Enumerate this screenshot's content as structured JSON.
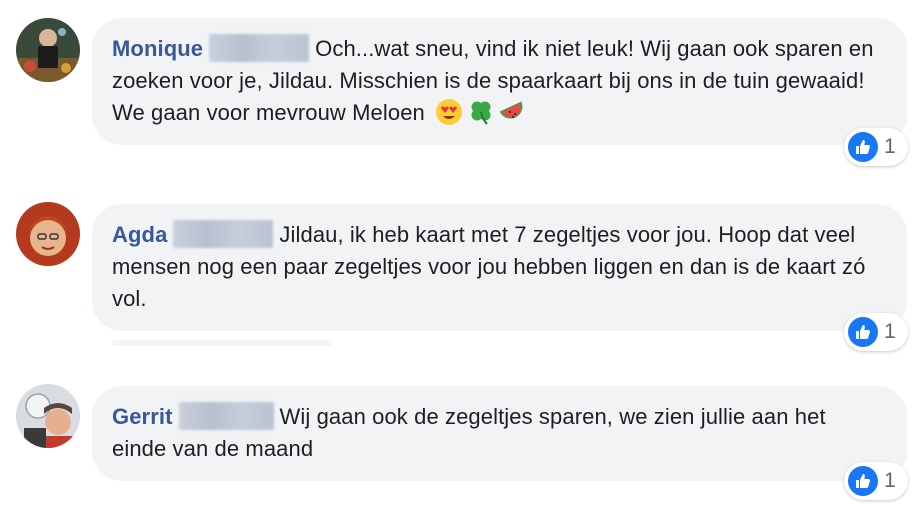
{
  "comments": [
    {
      "author": "Monique",
      "text": "Och...wat sneu, vind ik niet leuk! Wij gaan ook sparen en zoeken voor je, Jildau. Misschien is de spaarkaart bij ons in de tuin gewaaid! We gaan voor mevrouw Meloen",
      "emojis": [
        "heart-eyes-emoji",
        "four-leaf-clover-emoji",
        "watermelon-emoji"
      ],
      "reaction": {
        "icon": "like-icon",
        "count": "1"
      }
    },
    {
      "author": "Agda",
      "text": "Jildau, ik heb kaart met 7 zegeltjes voor jou. Hoop dat veel mensen nog een paar zegeltjes voor jou hebben liggen en dan is de kaart zó vol.",
      "reaction": {
        "icon": "like-icon",
        "count": "1"
      }
    },
    {
      "author": "Gerrit",
      "text": "Wij gaan ook de zegeltjes sparen, we zien jullie aan het einde van de maand",
      "reaction": {
        "icon": "like-icon",
        "count": "1"
      }
    }
  ],
  "colors": {
    "author": "#385898",
    "bubble": "#f2f3f5",
    "like": "#1877f2",
    "text": "#1c1e21"
  }
}
